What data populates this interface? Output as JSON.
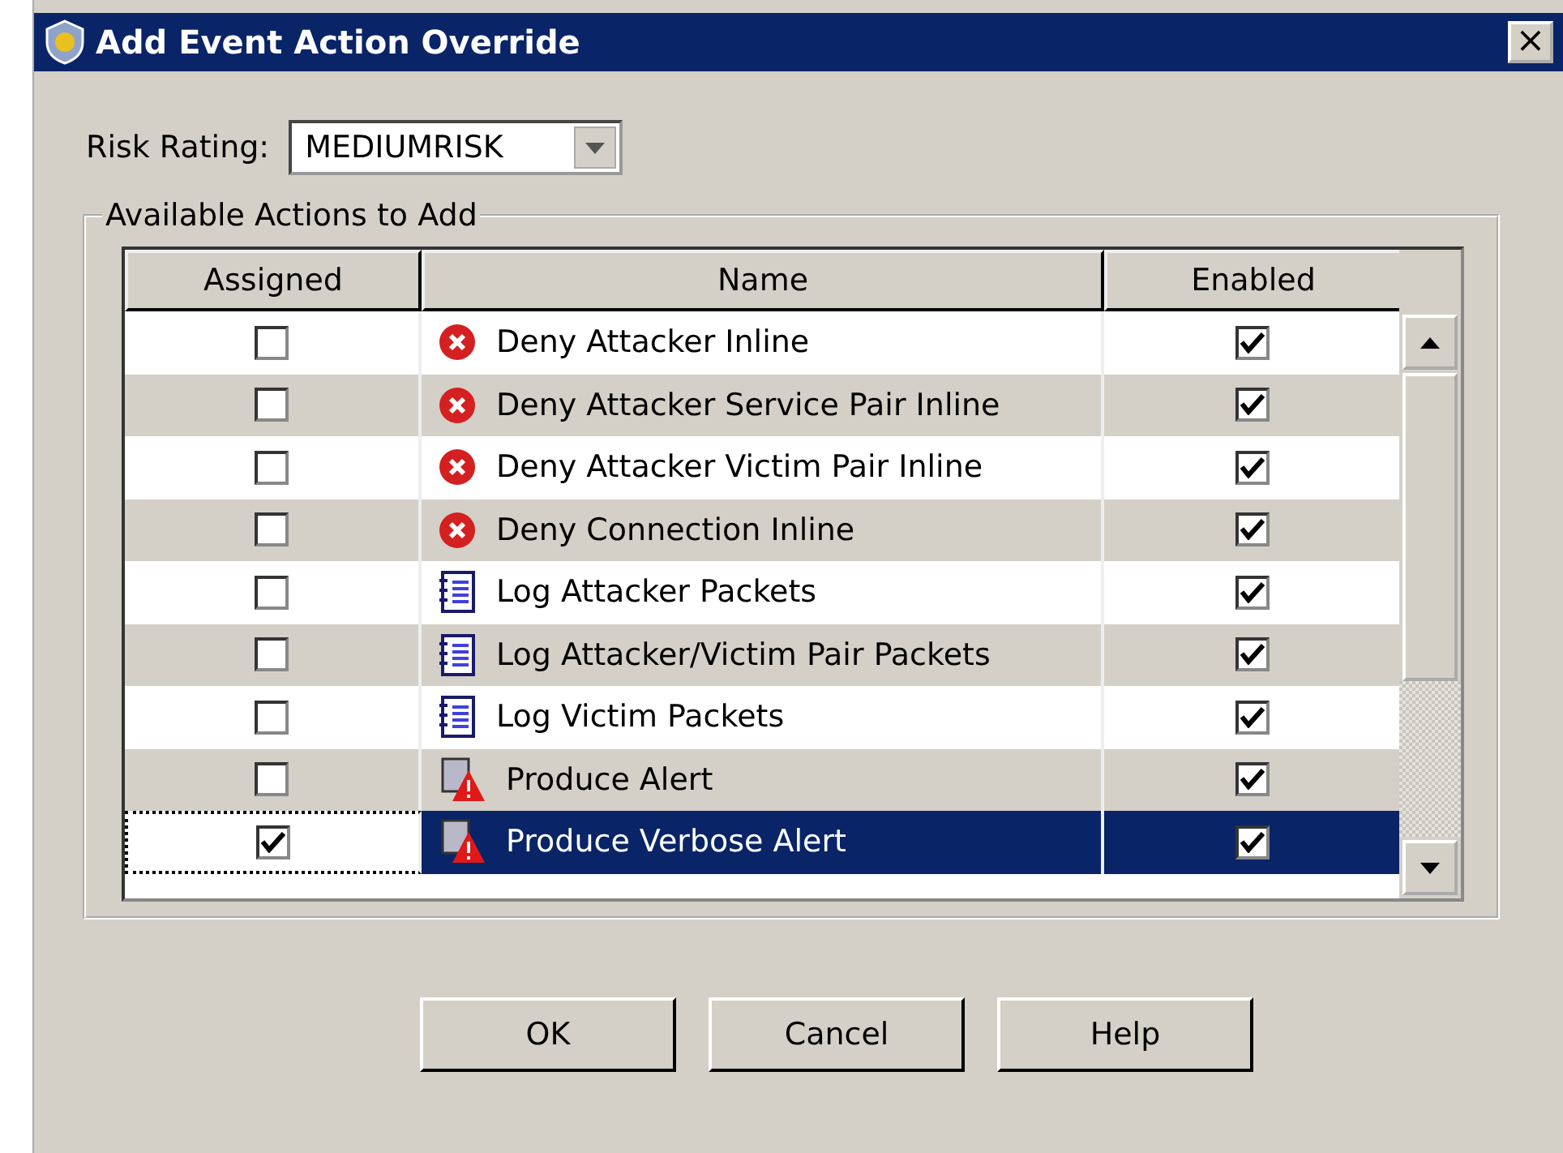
{
  "window": {
    "title": "Add Event Action Override",
    "close": "×"
  },
  "risk_rating": {
    "label": "Risk Rating:",
    "value": "MEDIUMRISK"
  },
  "group": {
    "title": "Available Actions to Add"
  },
  "table": {
    "columns": [
      "Assigned",
      "Name",
      "Enabled"
    ],
    "rows": [
      {
        "assigned": false,
        "kind": "deny",
        "name": "Deny Attacker Inline",
        "enabled": true,
        "selected": false
      },
      {
        "assigned": false,
        "kind": "deny",
        "name": "Deny Attacker Service Pair Inline",
        "enabled": true,
        "selected": false
      },
      {
        "assigned": false,
        "kind": "deny",
        "name": "Deny Attacker Victim Pair Inline",
        "enabled": true,
        "selected": false
      },
      {
        "assigned": false,
        "kind": "deny",
        "name": "Deny Connection Inline",
        "enabled": true,
        "selected": false
      },
      {
        "assigned": false,
        "kind": "log",
        "name": "Log Attacker Packets",
        "enabled": true,
        "selected": false
      },
      {
        "assigned": false,
        "kind": "log",
        "name": "Log Attacker/Victim Pair Packets",
        "enabled": true,
        "selected": false
      },
      {
        "assigned": false,
        "kind": "log",
        "name": "Log Victim Packets",
        "enabled": true,
        "selected": false
      },
      {
        "assigned": false,
        "kind": "alert",
        "name": "Produce Alert",
        "enabled": true,
        "selected": false
      },
      {
        "assigned": true,
        "kind": "alert",
        "name": "Produce Verbose Alert",
        "enabled": true,
        "selected": true
      }
    ]
  },
  "buttons": [
    "OK",
    "Cancel",
    "Help"
  ]
}
